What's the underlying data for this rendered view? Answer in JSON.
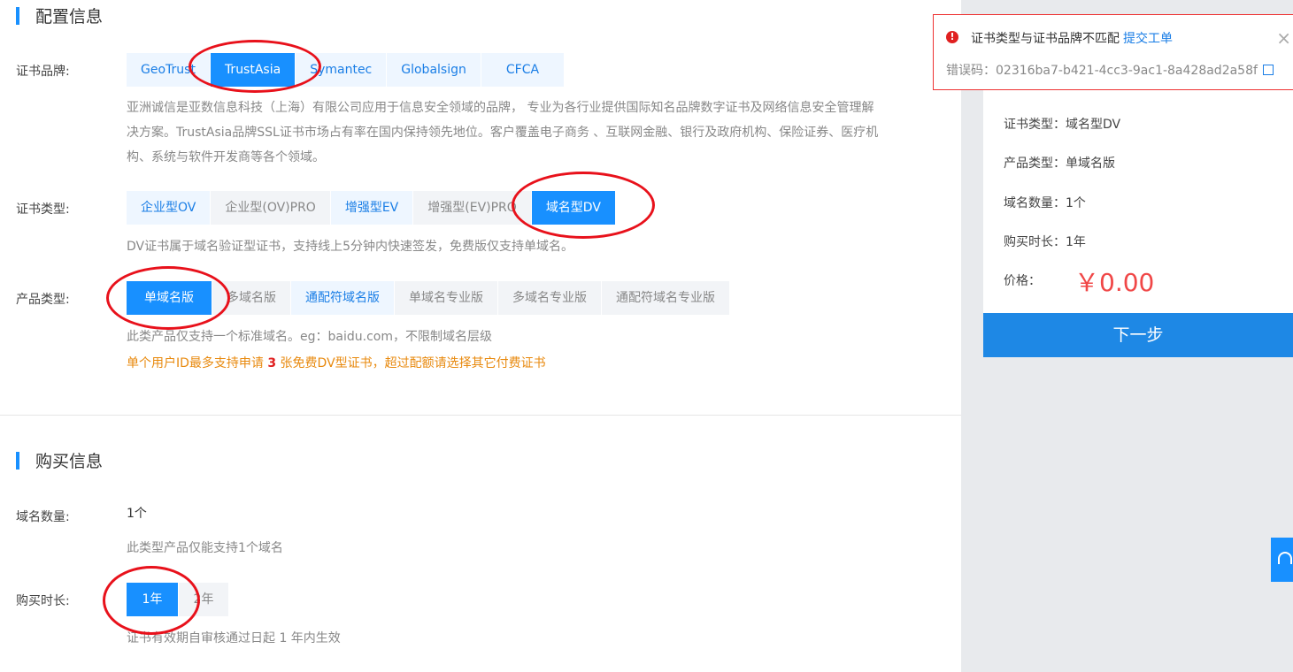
{
  "config": {
    "title": "配置信息",
    "brand_label": "证书品牌:",
    "brands": [
      "GeoTrust",
      "TrustAsia",
      "Symantec",
      "Globalsign",
      "CFCA"
    ],
    "brand_desc_lines": [
      "亚洲诚信是亚数信息科技（上海）有限公司应用于信息安全领域的品牌， 专业为各行业提供国际知名品牌数字证书及网络信息安全管理解",
      "决方案。TrustAsia品牌SSL证书市场占有率在国内保持领先地位。客户覆盖电子商务 、互联网金融、银行及政府机构、保险证券、医疗机",
      "构、系统与软件开发商等各个领域。"
    ],
    "cert_type_label": "证书类型:",
    "cert_types": [
      "企业型OV",
      "企业型(OV)PRO",
      "增强型EV",
      "增强型(EV)PRO",
      "域名型DV"
    ],
    "cert_type_desc": "DV证书属于域名验证型证书，支持线上5分钟内快速签发，免费版仅支持单域名。",
    "product_type_label": "产品类型:",
    "product_types": [
      "单域名版",
      "多域名版",
      "通配符域名版",
      "单域名专业版",
      "多域名专业版",
      "通配符域名专业版"
    ],
    "product_desc": "此类产品仅支持一个标准域名。eg：baidu.com，不限制域名层级",
    "warn_prefix": "单个用户ID最多支持申请 ",
    "warn_count": "3",
    "warn_suffix": " 张免费DV型证书，超过配额请选择其它付费证书"
  },
  "purchase": {
    "title": "购买信息",
    "domain_count_label": "域名数量:",
    "domain_count_value": "1个",
    "domain_count_desc": "此类型产品仅能支持1个域名",
    "duration_label": "购买时长:",
    "durations": [
      "1年",
      "2年"
    ],
    "duration_desc": "证书有效期自审核通过日起 1 年内生效"
  },
  "summary": {
    "cert_type": "证书类型：域名型DV",
    "product_type": "产品类型：单域名版",
    "domain_count": "域名数量：1个",
    "duration": "购买时长：1年",
    "price_label": "价格：",
    "price": "￥0.00",
    "next_button": "下一步"
  },
  "toast": {
    "message": "证书类型与证书品牌不匹配",
    "link": "提交工单",
    "code": "错误码：02316ba7-b421-4cc3-9ac1-8a428ad2a58f",
    "close": "×",
    "icon_glyph": "!"
  },
  "colors": {
    "accent": "#1890ff",
    "price": "#f04747",
    "warning": "#e8890d",
    "annotation": "#e8111b"
  }
}
